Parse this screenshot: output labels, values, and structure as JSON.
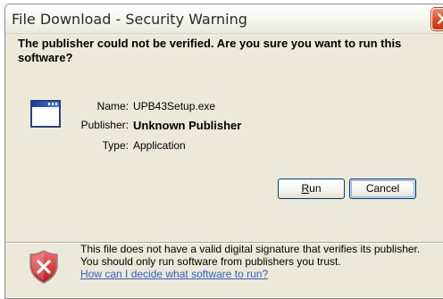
{
  "window": {
    "title": "File Download - Security Warning"
  },
  "question": "The publisher could not be verified.  Are you sure you want to run this software?",
  "fields": [
    {
      "label": "Name:",
      "value": "UPB43Setup.exe"
    },
    {
      "label": "Publisher:",
      "value": "Unknown Publisher"
    },
    {
      "label": "Type:",
      "value": "Application"
    }
  ],
  "buttons": {
    "run_prefix": "",
    "run_mnemonic": "R",
    "run_rest": "un",
    "cancel": "Cancel"
  },
  "warning": {
    "text": "This file does not have a valid digital signature that verifies its publisher.  You should only run software from publishers you trust.",
    "link": "How can I decide what software to run?"
  },
  "colors": {
    "dialog_bg": "#ece9d8",
    "link": "#315ec8",
    "close_button": "#d8431c",
    "shield": "#cc2a2a"
  },
  "icons": {
    "app": "application-window-icon",
    "shield": "security-shield-icon",
    "close": "close-icon"
  }
}
